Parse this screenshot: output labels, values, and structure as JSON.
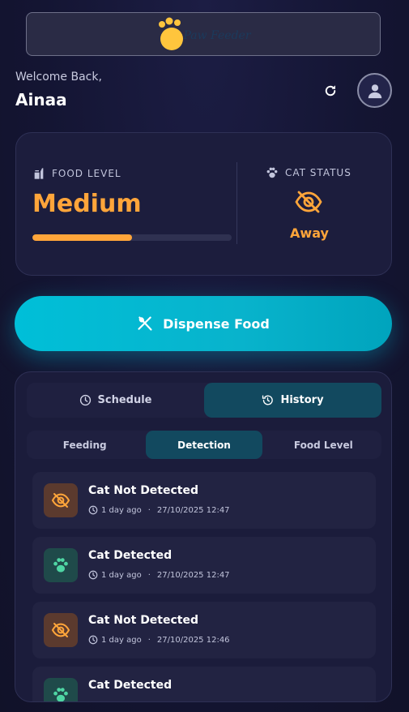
{
  "header": {
    "logo_text": "Paw Feeder",
    "welcome": "Welcome Back,",
    "username": "Ainaa"
  },
  "status": {
    "food_label": "FOOD LEVEL",
    "food_value": "Medium",
    "food_level_fraction": 0.5,
    "cat_label": "CAT STATUS",
    "cat_value": "Away"
  },
  "dispense": {
    "label": "Dispense Food"
  },
  "tabs": {
    "schedule": "Schedule",
    "history": "History"
  },
  "subtabs": {
    "feeding": "Feeding",
    "detection": "Detection",
    "food_level": "Food Level"
  },
  "history": [
    {
      "title": "Cat Not Detected",
      "ago": "1 day ago",
      "separator": "·",
      "time": "27/10/2025 12:47",
      "icon": "eye-off-icon"
    },
    {
      "title": "Cat Detected",
      "ago": "1 day ago",
      "separator": "·",
      "time": "27/10/2025 12:47",
      "icon": "paw-icon"
    },
    {
      "title": "Cat Not Detected",
      "ago": "1 day ago",
      "separator": "·",
      "time": "27/10/2025 12:46",
      "icon": "eye-off-icon"
    },
    {
      "title": "Cat Detected",
      "ago": "",
      "separator": "",
      "time": "",
      "icon": "paw-icon"
    }
  ],
  "colors": {
    "accent_orange": "#ffa53a",
    "accent_cyan": "#00bfd8",
    "active_tab": "#12495f",
    "paw_green": "#4fd6a4"
  }
}
